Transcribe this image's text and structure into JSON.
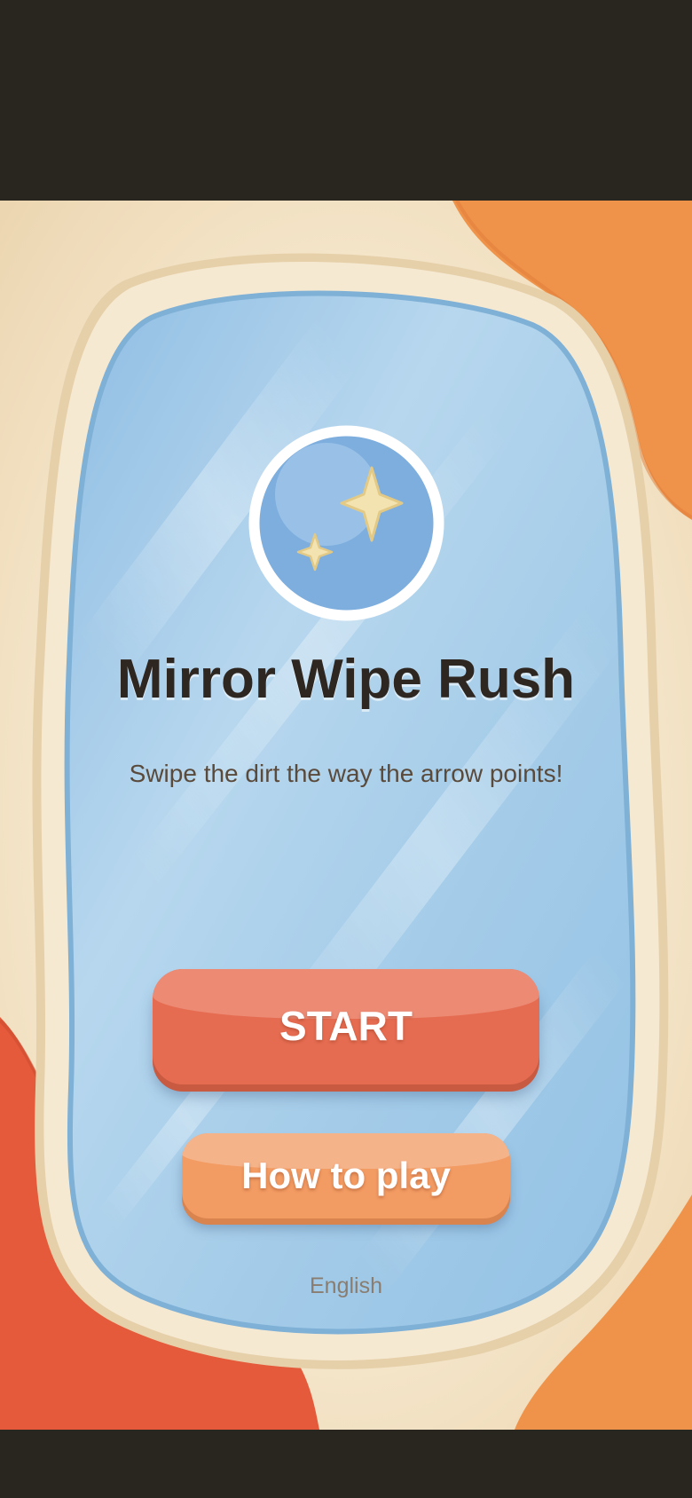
{
  "game": {
    "title": "Mirror Wipe Rush",
    "subtitle": "Swipe the dirt the way the arrow points!",
    "start_label": "START",
    "howto_label": "How to play",
    "language_label": "English"
  },
  "icons": {
    "logo": "mirror-sparkle-icon"
  },
  "colors": {
    "letterbox": "#29251f",
    "frame_cream": "#f3e2c4",
    "mirror_blue": "#a9cfe9",
    "start_button": "#e56c50",
    "howto_button": "#f29b62",
    "blob_orange": "#f0934a",
    "blob_red": "#e45a3a",
    "title_text": "#2e2620"
  }
}
